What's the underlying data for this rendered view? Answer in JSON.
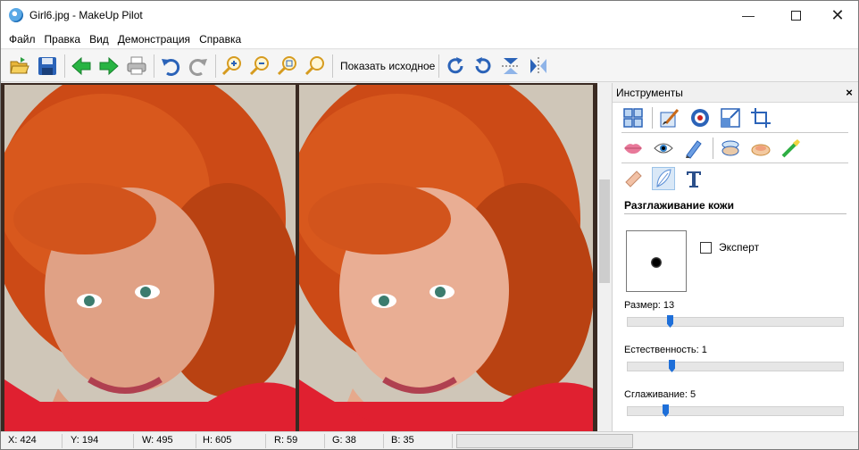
{
  "window": {
    "title": "Girl6.jpg - MakeUp Pilot"
  },
  "menu": [
    "Файл",
    "Правка",
    "Вид",
    "Демонстрация",
    "Справка"
  ],
  "toolbar": {
    "show_original_label": "Показать исходное"
  },
  "panel": {
    "title": "Инструменты",
    "close_label": "×",
    "section_title": "Разглаживание кожи",
    "expert_label": "Эксперт",
    "expert_checked": false,
    "size_label": "Размер: 13",
    "size_value": 13,
    "naturalness_label": "Естественность: 1",
    "naturalness_value": 1,
    "smoothing_label": "Сглаживание: 5",
    "smoothing_value": 5
  },
  "status": {
    "x": "X: 424",
    "y": "Y: 194",
    "w": "W: 495",
    "h": "H: 605",
    "r": "R: 59",
    "g": "G: 38",
    "b": "B: 35"
  },
  "colors": {
    "accent": "#1e6fd9",
    "hair": "#d2541c",
    "sweater": "#e02030"
  }
}
